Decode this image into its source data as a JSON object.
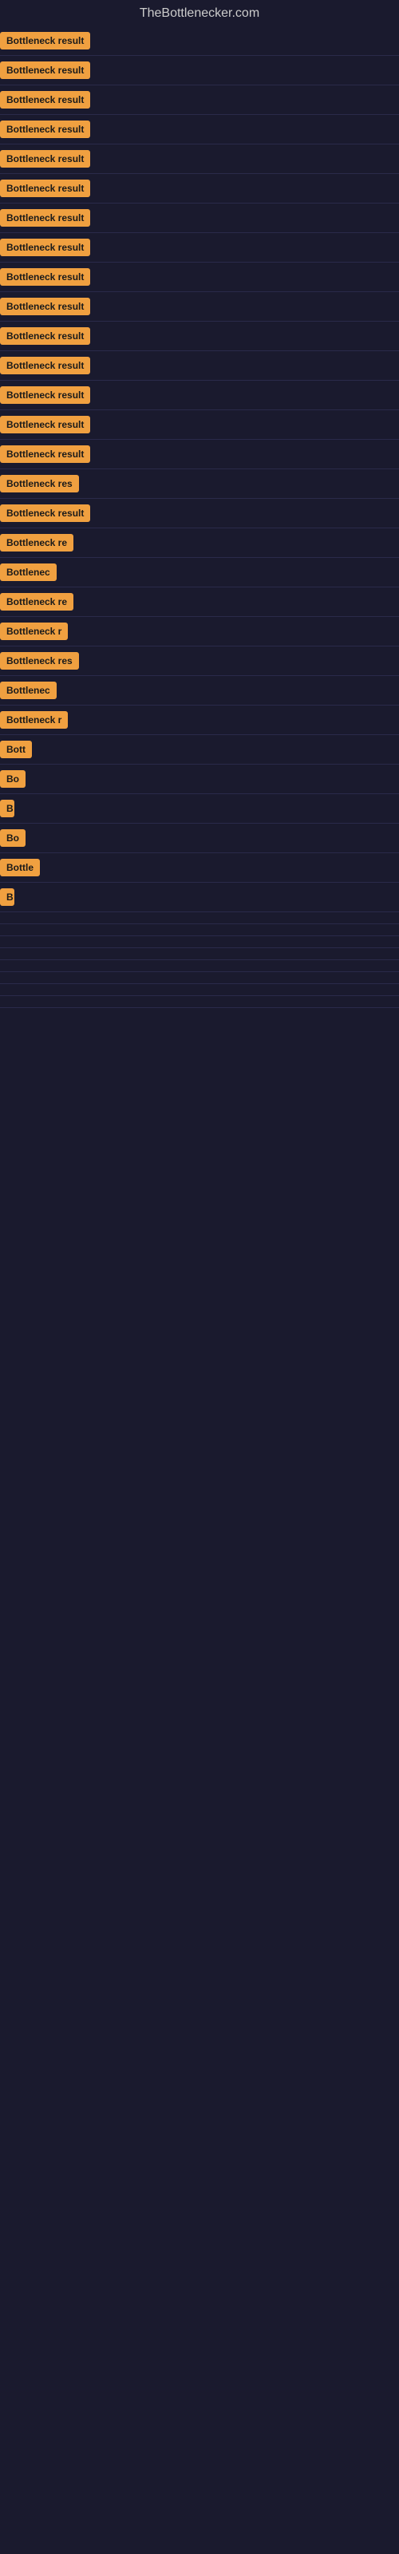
{
  "site": {
    "title": "TheBottlenecker.com"
  },
  "items": [
    {
      "label": "Bottleneck result",
      "width": 150
    },
    {
      "label": "Bottleneck result",
      "width": 150
    },
    {
      "label": "Bottleneck result",
      "width": 150
    },
    {
      "label": "Bottleneck result",
      "width": 150
    },
    {
      "label": "Bottleneck result",
      "width": 150
    },
    {
      "label": "Bottleneck result",
      "width": 150
    },
    {
      "label": "Bottleneck result",
      "width": 150
    },
    {
      "label": "Bottleneck result",
      "width": 150
    },
    {
      "label": "Bottleneck result",
      "width": 150
    },
    {
      "label": "Bottleneck result",
      "width": 150
    },
    {
      "label": "Bottleneck result",
      "width": 150
    },
    {
      "label": "Bottleneck result",
      "width": 150
    },
    {
      "label": "Bottleneck result",
      "width": 150
    },
    {
      "label": "Bottleneck result",
      "width": 150
    },
    {
      "label": "Bottleneck result",
      "width": 150
    },
    {
      "label": "Bottleneck res",
      "width": 130
    },
    {
      "label": "Bottleneck result",
      "width": 150
    },
    {
      "label": "Bottleneck re",
      "width": 118
    },
    {
      "label": "Bottlenec",
      "width": 90
    },
    {
      "label": "Bottleneck re",
      "width": 118
    },
    {
      "label": "Bottleneck r",
      "width": 105
    },
    {
      "label": "Bottleneck res",
      "width": 130
    },
    {
      "label": "Bottlenec",
      "width": 90
    },
    {
      "label": "Bottleneck r",
      "width": 105
    },
    {
      "label": "Bott",
      "width": 48
    },
    {
      "label": "Bo",
      "width": 32
    },
    {
      "label": "B",
      "width": 18
    },
    {
      "label": "Bo",
      "width": 32
    },
    {
      "label": "Bottle",
      "width": 58
    },
    {
      "label": "B",
      "width": 18
    },
    {
      "label": "",
      "width": 0
    },
    {
      "label": "",
      "width": 0
    },
    {
      "label": "",
      "width": 0
    },
    {
      "label": "",
      "width": 0
    },
    {
      "label": "",
      "width": 0
    },
    {
      "label": "",
      "width": 0
    },
    {
      "label": "",
      "width": 0
    },
    {
      "label": "",
      "width": 0
    }
  ]
}
